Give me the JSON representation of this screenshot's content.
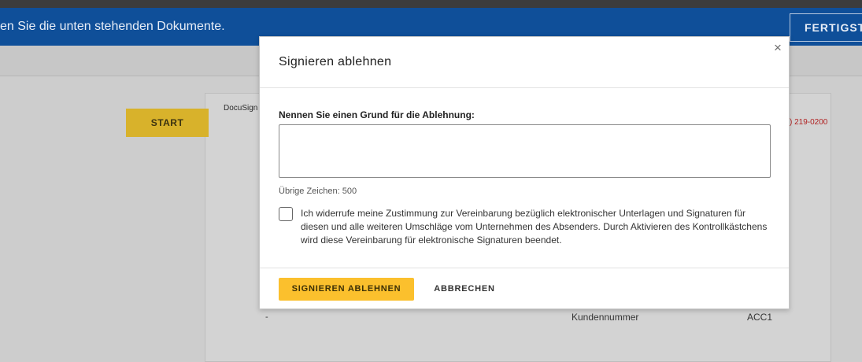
{
  "banner": {
    "text": "en Sie die unten stehenden Dokumente.",
    "finish_label": "FERTIGSTELLEN"
  },
  "document": {
    "start_label": "START",
    "logo_text": "DocuSign",
    "phone_fragment": ") 219-0200",
    "dash": "-",
    "customer_number_label": "Kundennummer",
    "customer_number_value": "ACC1"
  },
  "modal": {
    "title": "Signieren ablehnen",
    "close_icon": "×",
    "reason_label": "Nennen Sie einen Grund für die Ablehnung:",
    "reason_value": "",
    "remaining_chars": "Übrige Zeichen: 500",
    "consent_checked": false,
    "consent_text": "Ich widerrufe meine Zustimmung zur Vereinbarung bezüglich elektronischer Unterlagen und Signaturen für diesen und alle weiteren Umschläge vom Unternehmen des Absenders. Durch Aktivieren des Kontrollkästchens wird diese Vereinbarung für elektronische Signaturen beendet.",
    "decline_label": "SIGNIEREN ABLEHNEN",
    "cancel_label": "ABBRECHEN"
  },
  "colors": {
    "banner": "#0f4f99",
    "primary_button": "#fbc02d",
    "start_button": "#d8b22b"
  }
}
